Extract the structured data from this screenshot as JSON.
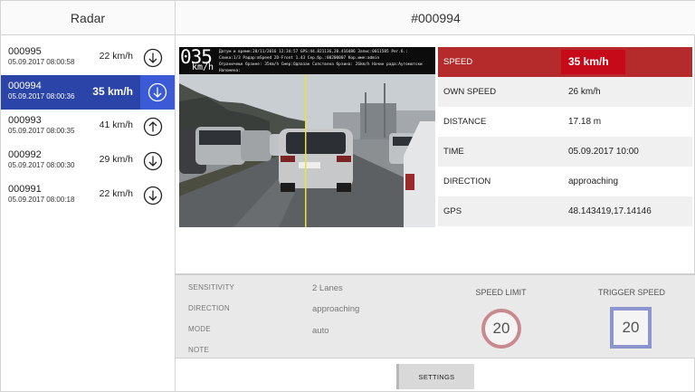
{
  "left_title": "Radar",
  "detail_title": "#000994",
  "list": [
    {
      "id": "000995",
      "date": "05.09.2017 08:00:58",
      "speed": "22 km/h",
      "direction": "approaching"
    },
    {
      "id": "000994",
      "date": "05.09.2017 08:00:36",
      "speed": "35 km/h",
      "direction": "approaching",
      "selected": true
    },
    {
      "id": "000993",
      "date": "05.09.2017 08:00:35",
      "speed": "41 km/h",
      "direction": "receding"
    },
    {
      "id": "000992",
      "date": "05.09.2017 08:00:30",
      "speed": "29 km/h",
      "direction": "approaching"
    },
    {
      "id": "000991",
      "date": "05.09.2017 08:00:18",
      "speed": "22 km/h",
      "direction": "approaching"
    }
  ],
  "photo": {
    "overlay_speed": "035",
    "overlay_unit": "km/h",
    "overlay_lines": [
      "Датум и време:28/11/2016 12:34:57   GPS:44.821136,20.416486   Запис:0011585 Рег.б.:",
      "Слика:1/3   Радар:mSpeed 2D-Front 1.43   Сер.бр.:00200007  Кор.име:admin",
      "Ограничење брзине: 35km/h Смер:Одлазак Сопствена брзина: 26km/h Начин рада:Аутоматски",
      "Напомена:"
    ]
  },
  "info": {
    "speed_label": "SPEED",
    "speed_value": "35 km/h",
    "own_speed_label": "OWN SPEED",
    "own_speed_value": "26 km/h",
    "distance_label": "DISTANCE",
    "distance_value": "17.18 m",
    "time_label": "TIME",
    "time_value": "05.09.2017 10:00",
    "direction_label": "DIRECTION",
    "direction_value": "approaching",
    "gps_label": "GPS",
    "gps_value": "48.143419,17.14146"
  },
  "settings": {
    "sensitivity_label": "SENSITIVITY",
    "sensitivity_value": "2 Lanes",
    "direction_label": "DIRECTION",
    "direction_value": "approaching",
    "mode_label": "MODE",
    "mode_value": "auto",
    "note_label": "NOTE",
    "speed_limit_label": "SPEED LIMIT",
    "speed_limit_value": "20",
    "trigger_speed_label": "TRIGGER SPEED",
    "trigger_speed_value": "20",
    "button_label": "SETTINGS"
  },
  "colors": {
    "selected_row": "#2a44a8",
    "selected_button": "#3b5bd6",
    "speed_row": "#b52b2b",
    "speed_value_box": "#c60a1a",
    "limit_ring": "#c98a8f",
    "trigger_ring": "#8d95cf"
  },
  "icons": {
    "approaching": "arrow-down-circle-icon",
    "receding": "arrow-up-circle-icon"
  }
}
